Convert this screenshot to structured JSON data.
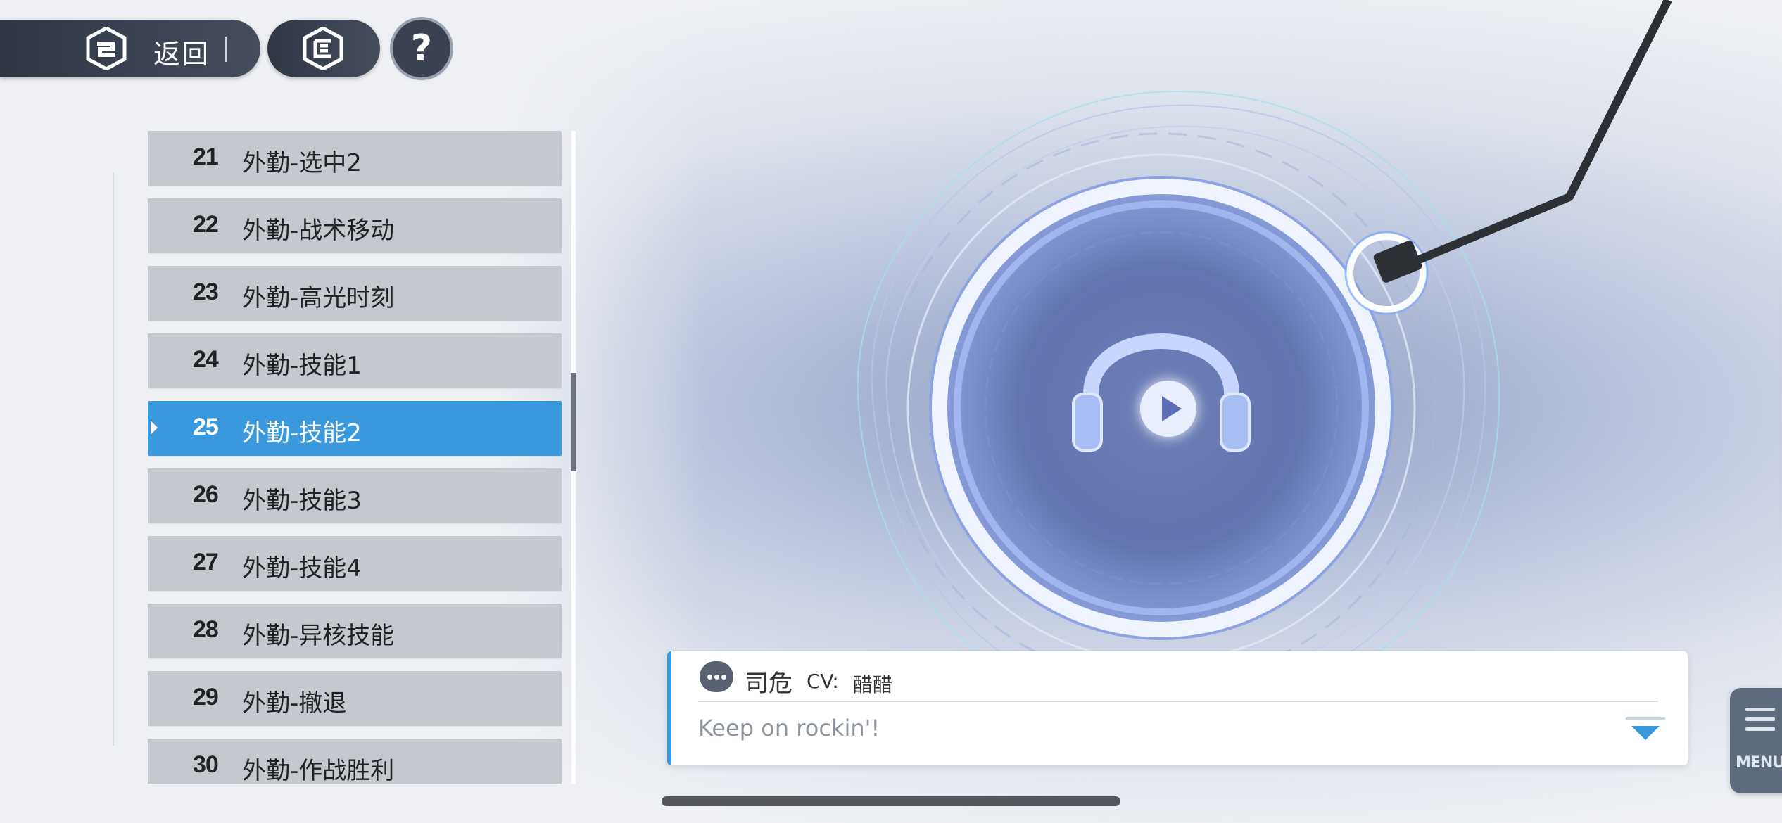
{
  "header": {
    "back_label": "返回",
    "help_label": "?"
  },
  "voice_list": {
    "items": [
      {
        "num": "21",
        "name": "外勤-选中2"
      },
      {
        "num": "22",
        "name": "外勤-战术移动"
      },
      {
        "num": "23",
        "name": "外勤-高光时刻"
      },
      {
        "num": "24",
        "name": "外勤-技能1"
      },
      {
        "num": "25",
        "name": "外勤-技能2",
        "selected": true
      },
      {
        "num": "26",
        "name": "外勤-技能3"
      },
      {
        "num": "27",
        "name": "外勤-技能4"
      },
      {
        "num": "28",
        "name": "外勤-异核技能"
      },
      {
        "num": "29",
        "name": "外勤-撤退"
      },
      {
        "num": "30",
        "name": "外勤-作战胜利"
      }
    ]
  },
  "dialog": {
    "speaker": "司危",
    "cv_label": "CV:",
    "cv_name": "醋醋",
    "line": "Keep on rockin'!"
  },
  "menu": {
    "label": "MENU"
  },
  "colors": {
    "accent": "#3a98dc",
    "dark_button": "#3a4150",
    "list_item_bg": "#c4c9cf"
  },
  "icons": {
    "back": "app-logo-icon",
    "home": "home-logo-icon",
    "help": "question-icon",
    "play": "play-icon",
    "headphones": "headphones-icon",
    "chat": "chat-bubble-icon",
    "menu": "hamburger-icon",
    "next": "triangle-down-icon"
  }
}
